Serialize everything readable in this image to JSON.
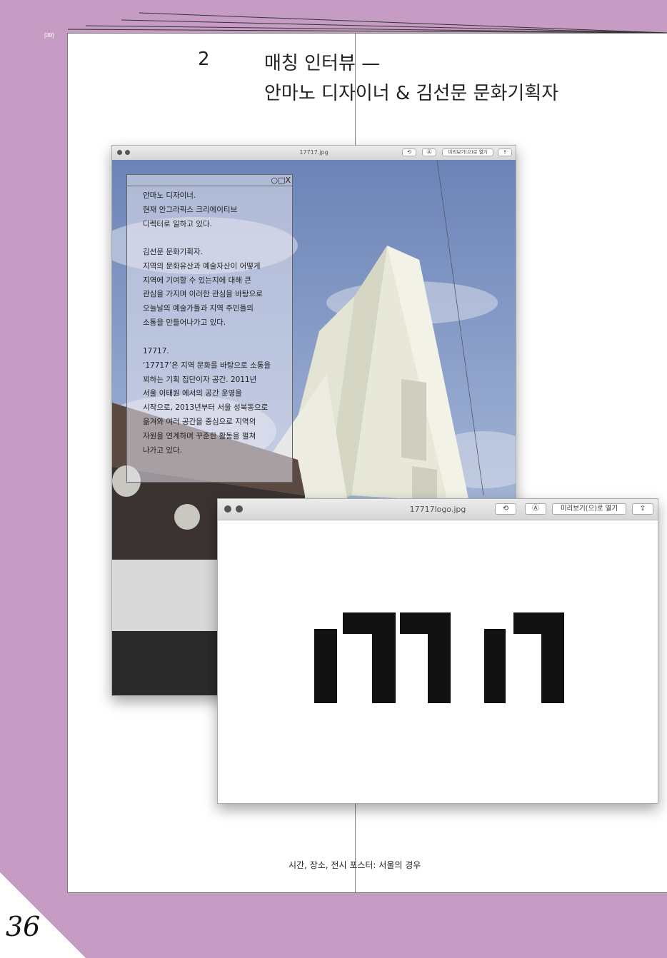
{
  "page_code": "[39]",
  "chapter_number": "2",
  "title_line1": "매칭 인터뷰 —",
  "title_line2": "안마노 디자이너 & 김선문 문화기획자",
  "window_photo": {
    "title": "17717.jpg",
    "open_button": "미리보기(으)로 열기"
  },
  "textbox": {
    "controls": "○□X",
    "para1": "안마노 디자이너.\n현재 안그라픽스 크리에이티브\n디렉터로 일하고 있다.",
    "para2": "김선문 문화기획자.\n지역의 문화유산과 예술자산이 어떻게\n지역에 기여할 수 있는지에 대해 큰\n관심을 가지며 이러한 관심을 바탕으로\n오늘날의 예술가들과 지역 주민들의\n소통을 만들어나가고 있다.",
    "para3": "17717.\n‘17717’은 지역 문화를 바탕으로 소통을\n꾀하는 기획 집단이자 공간. 2011년\n서울 이태원 에서의 공간 운영을\n시작으로, 2013년부터 서울 성북동으로\n옮겨와 여러 공간을 중심으로 지역의\n자원을 연계하며 꾸준한 활동을 펼쳐\n나가고 있다."
  },
  "window_logo": {
    "title": "17717logo.jpg",
    "open_button": "미리보기(으)로 열기"
  },
  "caption": "시간, 장소, 전시 포스터: 서울의 경우",
  "page_number": "36",
  "colors": {
    "background": "#c69cc4",
    "page": "#ffffff",
    "logo": "#111111"
  }
}
